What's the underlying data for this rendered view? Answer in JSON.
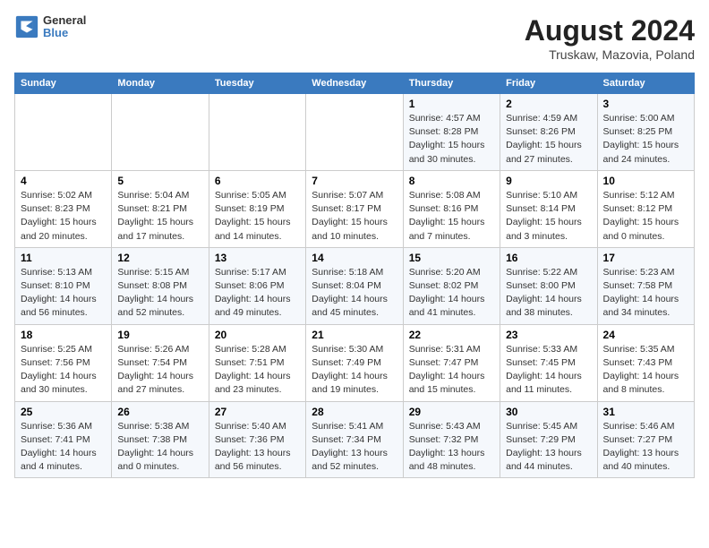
{
  "header": {
    "logo": {
      "general": "General",
      "blue": "Blue"
    },
    "title": "August 2024",
    "subtitle": "Truskaw, Mazovia, Poland"
  },
  "weekdays": [
    "Sunday",
    "Monday",
    "Tuesday",
    "Wednesday",
    "Thursday",
    "Friday",
    "Saturday"
  ],
  "weeks": [
    [
      {
        "day": "",
        "info": ""
      },
      {
        "day": "",
        "info": ""
      },
      {
        "day": "",
        "info": ""
      },
      {
        "day": "",
        "info": ""
      },
      {
        "day": "1",
        "info": "Sunrise: 4:57 AM\nSunset: 8:28 PM\nDaylight: 15 hours\nand 30 minutes."
      },
      {
        "day": "2",
        "info": "Sunrise: 4:59 AM\nSunset: 8:26 PM\nDaylight: 15 hours\nand 27 minutes."
      },
      {
        "day": "3",
        "info": "Sunrise: 5:00 AM\nSunset: 8:25 PM\nDaylight: 15 hours\nand 24 minutes."
      }
    ],
    [
      {
        "day": "4",
        "info": "Sunrise: 5:02 AM\nSunset: 8:23 PM\nDaylight: 15 hours\nand 20 minutes."
      },
      {
        "day": "5",
        "info": "Sunrise: 5:04 AM\nSunset: 8:21 PM\nDaylight: 15 hours\nand 17 minutes."
      },
      {
        "day": "6",
        "info": "Sunrise: 5:05 AM\nSunset: 8:19 PM\nDaylight: 15 hours\nand 14 minutes."
      },
      {
        "day": "7",
        "info": "Sunrise: 5:07 AM\nSunset: 8:17 PM\nDaylight: 15 hours\nand 10 minutes."
      },
      {
        "day": "8",
        "info": "Sunrise: 5:08 AM\nSunset: 8:16 PM\nDaylight: 15 hours\nand 7 minutes."
      },
      {
        "day": "9",
        "info": "Sunrise: 5:10 AM\nSunset: 8:14 PM\nDaylight: 15 hours\nand 3 minutes."
      },
      {
        "day": "10",
        "info": "Sunrise: 5:12 AM\nSunset: 8:12 PM\nDaylight: 15 hours\nand 0 minutes."
      }
    ],
    [
      {
        "day": "11",
        "info": "Sunrise: 5:13 AM\nSunset: 8:10 PM\nDaylight: 14 hours\nand 56 minutes."
      },
      {
        "day": "12",
        "info": "Sunrise: 5:15 AM\nSunset: 8:08 PM\nDaylight: 14 hours\nand 52 minutes."
      },
      {
        "day": "13",
        "info": "Sunrise: 5:17 AM\nSunset: 8:06 PM\nDaylight: 14 hours\nand 49 minutes."
      },
      {
        "day": "14",
        "info": "Sunrise: 5:18 AM\nSunset: 8:04 PM\nDaylight: 14 hours\nand 45 minutes."
      },
      {
        "day": "15",
        "info": "Sunrise: 5:20 AM\nSunset: 8:02 PM\nDaylight: 14 hours\nand 41 minutes."
      },
      {
        "day": "16",
        "info": "Sunrise: 5:22 AM\nSunset: 8:00 PM\nDaylight: 14 hours\nand 38 minutes."
      },
      {
        "day": "17",
        "info": "Sunrise: 5:23 AM\nSunset: 7:58 PM\nDaylight: 14 hours\nand 34 minutes."
      }
    ],
    [
      {
        "day": "18",
        "info": "Sunrise: 5:25 AM\nSunset: 7:56 PM\nDaylight: 14 hours\nand 30 minutes."
      },
      {
        "day": "19",
        "info": "Sunrise: 5:26 AM\nSunset: 7:54 PM\nDaylight: 14 hours\nand 27 minutes."
      },
      {
        "day": "20",
        "info": "Sunrise: 5:28 AM\nSunset: 7:51 PM\nDaylight: 14 hours\nand 23 minutes."
      },
      {
        "day": "21",
        "info": "Sunrise: 5:30 AM\nSunset: 7:49 PM\nDaylight: 14 hours\nand 19 minutes."
      },
      {
        "day": "22",
        "info": "Sunrise: 5:31 AM\nSunset: 7:47 PM\nDaylight: 14 hours\nand 15 minutes."
      },
      {
        "day": "23",
        "info": "Sunrise: 5:33 AM\nSunset: 7:45 PM\nDaylight: 14 hours\nand 11 minutes."
      },
      {
        "day": "24",
        "info": "Sunrise: 5:35 AM\nSunset: 7:43 PM\nDaylight: 14 hours\nand 8 minutes."
      }
    ],
    [
      {
        "day": "25",
        "info": "Sunrise: 5:36 AM\nSunset: 7:41 PM\nDaylight: 14 hours\nand 4 minutes."
      },
      {
        "day": "26",
        "info": "Sunrise: 5:38 AM\nSunset: 7:38 PM\nDaylight: 14 hours\nand 0 minutes."
      },
      {
        "day": "27",
        "info": "Sunrise: 5:40 AM\nSunset: 7:36 PM\nDaylight: 13 hours\nand 56 minutes."
      },
      {
        "day": "28",
        "info": "Sunrise: 5:41 AM\nSunset: 7:34 PM\nDaylight: 13 hours\nand 52 minutes."
      },
      {
        "day": "29",
        "info": "Sunrise: 5:43 AM\nSunset: 7:32 PM\nDaylight: 13 hours\nand 48 minutes."
      },
      {
        "day": "30",
        "info": "Sunrise: 5:45 AM\nSunset: 7:29 PM\nDaylight: 13 hours\nand 44 minutes."
      },
      {
        "day": "31",
        "info": "Sunrise: 5:46 AM\nSunset: 7:27 PM\nDaylight: 13 hours\nand 40 minutes."
      }
    ]
  ]
}
